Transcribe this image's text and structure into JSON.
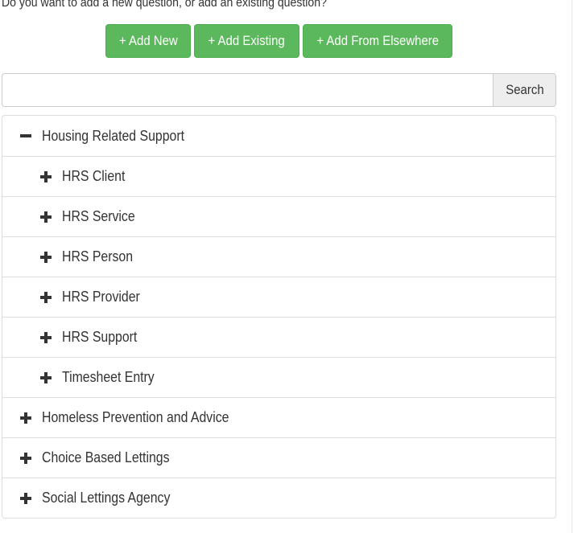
{
  "prompt_text": "Do you want to add a new question, or add an existing question?",
  "buttons": {
    "add_new": "+ Add New",
    "add_existing": "+ Add Existing",
    "add_elsewhere": "+ Add From Elsewhere"
  },
  "search": {
    "value": "",
    "button_label": "Search"
  },
  "tree": {
    "groups": [
      {
        "label": "Housing Related Support",
        "expanded": true,
        "children": [
          {
            "label": "HRS Client",
            "expanded": false
          },
          {
            "label": "HRS Service",
            "expanded": false
          },
          {
            "label": "HRS Person",
            "expanded": false
          },
          {
            "label": "HRS Provider",
            "expanded": false
          },
          {
            "label": "HRS Support",
            "expanded": false
          },
          {
            "label": "Timesheet Entry",
            "expanded": false
          }
        ]
      },
      {
        "label": "Homeless Prevention and Advice",
        "expanded": false
      },
      {
        "label": "Choice Based Lettings",
        "expanded": false
      },
      {
        "label": "Social Lettings Agency",
        "expanded": false
      }
    ]
  },
  "colors": {
    "button_green": "#5cb85c",
    "text": "#333333",
    "border": "#dddddd",
    "search_button_bg": "#eeeeee"
  },
  "icons": {
    "expanded": "minus-icon",
    "collapsed": "plus-icon"
  }
}
